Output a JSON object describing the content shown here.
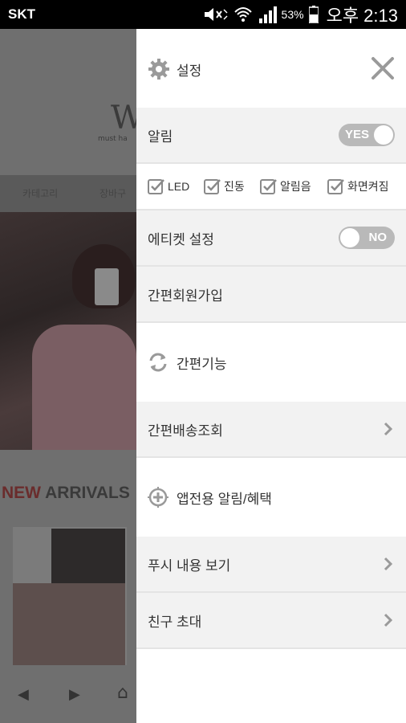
{
  "status_bar": {
    "carrier": "SKT",
    "battery_percent": "53%",
    "time": "오후 2:13"
  },
  "background_page": {
    "logo": "W",
    "tagline": "must ha",
    "nav": [
      "카테고리",
      "장바구"
    ],
    "section_new": "NEW",
    "section_arrivals": "ARRIVALS"
  },
  "drawer": {
    "header": {
      "title": "설정",
      "gear_icon": "gear-icon",
      "close_icon": "close-icon"
    },
    "notification": {
      "label": "알림",
      "toggle_text": "YES",
      "enabled": true
    },
    "options": [
      {
        "label": "LED",
        "checked": true
      },
      {
        "label": "진동",
        "checked": true
      },
      {
        "label": "알림음",
        "checked": true
      },
      {
        "label": "화면켜짐",
        "checked": true
      }
    ],
    "etiquette": {
      "label": "에티켓 설정",
      "toggle_text": "NO",
      "enabled": false
    },
    "easy_signup": {
      "label": "간편회원가입"
    },
    "easy_features": {
      "label": "간편기능",
      "icon": "refresh-icon"
    },
    "easy_delivery": {
      "label": "간편배송조회"
    },
    "app_benefits": {
      "label": "앱전용 알림/혜택",
      "icon": "plus-target-icon"
    },
    "push_view": {
      "label": "푸시 내용 보기"
    },
    "invite_friends": {
      "label": "친구 초대"
    }
  },
  "colors": {
    "toggle_gray": "#b9b9b9",
    "row_gray": "#f2f2f2",
    "icon_gray": "#9a9a9a",
    "dim_overlay": "#6e6e6e"
  }
}
